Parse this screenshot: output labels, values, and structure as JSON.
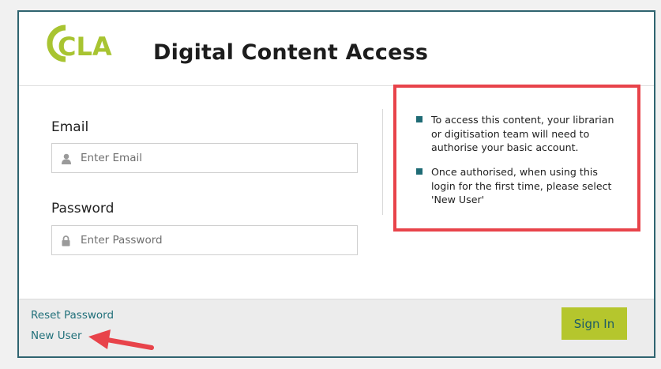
{
  "brand": {
    "logo_text": "CLA",
    "logo_color": "#a8c431"
  },
  "header": {
    "title": "Digital Content Access"
  },
  "form": {
    "email_label": "Email",
    "email_placeholder": "Enter Email",
    "password_label": "Password",
    "password_placeholder": "Enter Password"
  },
  "info": {
    "items": [
      "To access this content, your librarian or digitisation team will need to authorise your basic account.",
      "Once authorised, when using this login for the first time, please select 'New User'"
    ],
    "bullet_color": "#1f6b75",
    "highlight_color": "#e8434a"
  },
  "footer": {
    "reset_password": "Reset Password",
    "new_user": "New User",
    "sign_in": "Sign In"
  },
  "icons": {
    "user": "user-icon",
    "lock": "lock-icon",
    "arrow": "arrow-pointer-icon"
  }
}
